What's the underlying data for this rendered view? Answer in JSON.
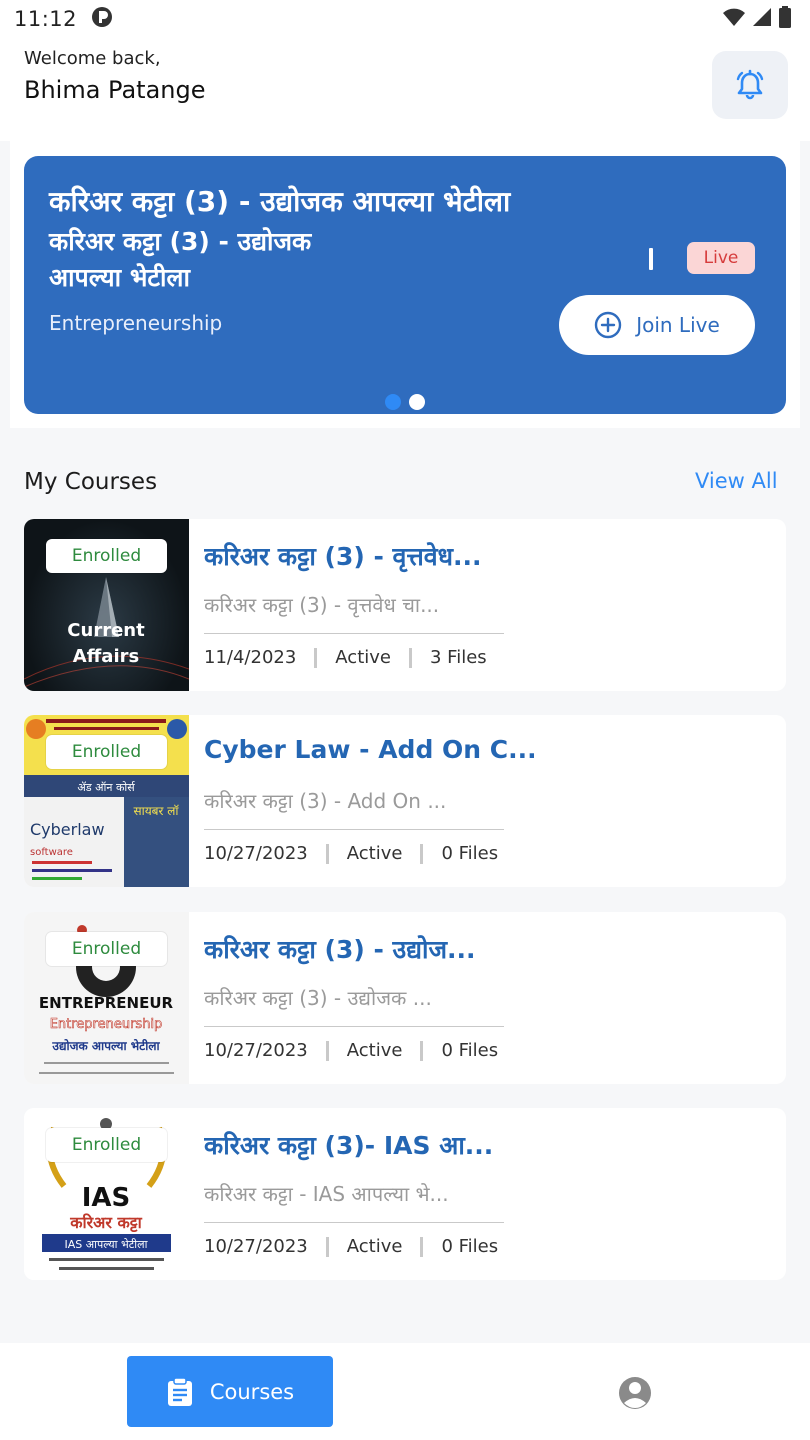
{
  "status_bar": {
    "time": "11:12"
  },
  "header": {
    "welcome": "Welcome back,",
    "user_name": "Bhima Patange"
  },
  "banner": {
    "title": "करिअर कट्टा (3) - उद्योजक आपल्या भेटीला",
    "subtitle": "करिअर कट्टा (3) - उद्योजक आपल्या भेटीला",
    "category": "Entrepreneurship",
    "live_label": "Live",
    "join_label": "Join Live",
    "slides_total": 2,
    "active_slide": 1
  },
  "courses_section": {
    "title": "My Courses",
    "view_all": "View All"
  },
  "courses": [
    {
      "badge": "Enrolled",
      "title": "करिअर कट्टा (3) - वृत्तवेध...",
      "subtitle": "करिअर कट्टा (3) - वृत्तवेध चा...",
      "date": "11/4/2023",
      "status": "Active",
      "files": "3 Files",
      "thumb_text": [
        "Current",
        "Affairs"
      ]
    },
    {
      "badge": "Enrolled",
      "title": "Cyber Law - Add On C...",
      "subtitle": "करिअर कट्टा (3) - Add On ...",
      "date": "10/27/2023",
      "status": "Active",
      "files": "0 Files",
      "thumb_text": [
        "ॲड ऑन कोर्स",
        "सायबर लॉ",
        "Cyberlaw",
        "software"
      ]
    },
    {
      "badge": "Enrolled",
      "title": "करिअर कट्टा (3) - उद्योज...",
      "subtitle": "करिअर कट्टा (3) - उद्योजक ...",
      "date": "10/27/2023",
      "status": "Active",
      "files": "0 Files",
      "thumb_text": [
        "ENTREPRENEUR",
        "Entrepreneurship",
        "उद्योजक आपल्या भेटीला"
      ]
    },
    {
      "badge": "Enrolled",
      "title": "करिअर कट्टा (3)- IAS आ...",
      "subtitle": "करिअर कट्टा - IAS आपल्या भे...",
      "date": "10/27/2023",
      "status": "Active",
      "files": "0 Files",
      "thumb_text": [
        "IAS",
        "करिअर कट्टा",
        "IAS आपल्या भेटीला"
      ]
    }
  ],
  "bottom_nav": {
    "courses_label": "Courses"
  },
  "colors": {
    "accent": "#2f8af5",
    "banner": "#2f6cbe",
    "course_title": "#2466b3",
    "enrolled": "#2e8b3e",
    "live": "#d63c3c"
  }
}
